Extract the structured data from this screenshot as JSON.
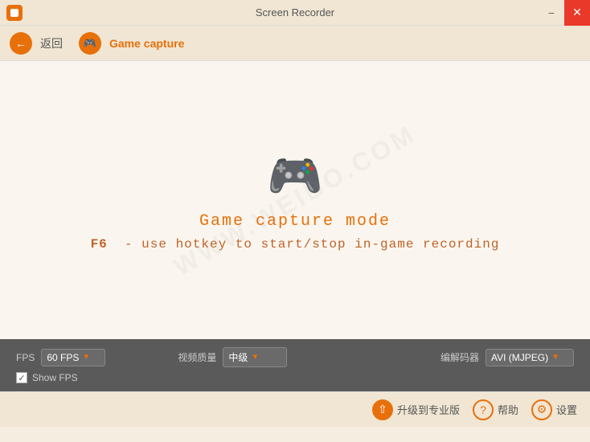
{
  "titleBar": {
    "title": "Screen Recorder",
    "minimize": "−",
    "close": "✕"
  },
  "subHeader": {
    "back_label": "返回",
    "game_capture_label": "Game capture"
  },
  "mainContent": {
    "mode_title": "Game  capture  mode",
    "hotkey_line": "F6  -  use hotkey to start/stop in-game recording"
  },
  "settings": {
    "fps_label": "FPS",
    "fps_value": "60 FPS",
    "quality_label": "视频质量",
    "quality_value": "中级",
    "encoder_label": "编解码器",
    "encoder_value": "AVI (MJPEG)",
    "show_fps_label": "Show FPS",
    "show_fps_checked": true
  },
  "footer": {
    "upgrade_label": "升级到专业版",
    "help_label": "帮助",
    "settings_label": "设置"
  }
}
